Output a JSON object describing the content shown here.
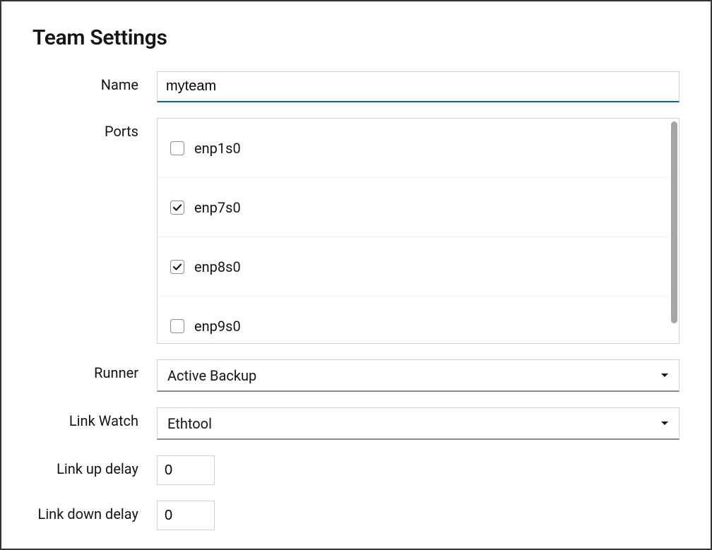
{
  "title": "Team Settings",
  "labels": {
    "name": "Name",
    "ports": "Ports",
    "runner": "Runner",
    "link_watch": "Link Watch",
    "link_up_delay": "Link up delay",
    "link_down_delay": "Link down delay"
  },
  "name": {
    "value": "myteam"
  },
  "ports": [
    {
      "label": "enp1s0",
      "checked": false
    },
    {
      "label": "enp7s0",
      "checked": true
    },
    {
      "label": "enp8s0",
      "checked": true
    },
    {
      "label": "enp9s0",
      "checked": false
    }
  ],
  "runner": {
    "value": "Active Backup"
  },
  "link_watch": {
    "value": "Ethtool"
  },
  "link_up_delay": {
    "value": "0"
  },
  "link_down_delay": {
    "value": "0"
  }
}
